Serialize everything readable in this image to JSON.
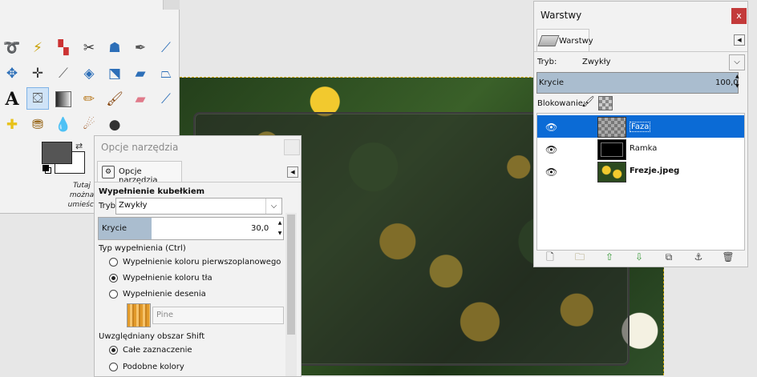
{
  "toolbox": {
    "hint_lines": [
      "Tutaj",
      "można",
      "umieści"
    ],
    "tool_icons": [
      "lasso-icon",
      "fuzzy-select-icon",
      "color-select-icon",
      "scissors-icon",
      "foreground-select-icon",
      "paths-icon",
      "color-picker-icon",
      "move-icon",
      "align-icon",
      "crop-icon",
      "rotate-icon",
      "scale-icon",
      "shear-icon",
      "perspective-icon",
      "text-icon",
      "bucket-fill-icon",
      "blend-icon",
      "pencil-icon",
      "paintbrush-icon",
      "eraser-icon",
      "airbrush-icon",
      "heal-icon",
      "clone-icon",
      "blur-icon",
      "smudge-icon",
      "dodge-icon"
    ]
  },
  "tool_options": {
    "title": "Opcje narzędzia",
    "tab_label": "Opcje narzędzia",
    "section_title": "Wypełnienie kubełkiem",
    "mode_label": "Tryb:",
    "mode_value": "Zwykły",
    "opacity_label": "Krycie",
    "opacity_value": "30,0",
    "opacity_fraction": 0.3,
    "fill_type_label": "Typ wypełnienia  (Ctrl)",
    "fill_options": [
      {
        "label": "Wypełnienie koloru pierwszoplanowego",
        "selected": false
      },
      {
        "label": "Wypełnienie koloru tła",
        "selected": true
      },
      {
        "label": "Wypełnienie desenia",
        "selected": false
      }
    ],
    "pattern_name": "Pine",
    "area_label": "Uwzględniany obszar  Shift",
    "area_options": [
      {
        "label": "Całe zaznaczenie",
        "selected": true
      },
      {
        "label": "Podobne kolory",
        "selected": false
      }
    ]
  },
  "layers": {
    "title": "Warstwy",
    "close_label": "x",
    "tab_label": "Warstwy",
    "mode_label": "Tryb:",
    "mode_value": "Zwykły",
    "opacity_label": "Krycie",
    "opacity_value": "100,0",
    "lock_label": "Blokowanie:",
    "items": [
      {
        "name": "Faza",
        "selected": true
      },
      {
        "name": "Ramka",
        "selected": false
      },
      {
        "name": "Frezje.jpeg",
        "selected": false
      }
    ],
    "bottom_buttons": [
      "new-layer-icon",
      "layer-group-icon",
      "raise-layer-icon",
      "lower-layer-icon",
      "duplicate-layer-icon",
      "anchor-layer-icon",
      "delete-layer-icon"
    ]
  },
  "colors": {
    "selection": "#0b6bd6",
    "opacity_bar": "#aabdcf",
    "close_red": "#c33a3a",
    "foreground": "#555555",
    "background": "#ffffff"
  }
}
